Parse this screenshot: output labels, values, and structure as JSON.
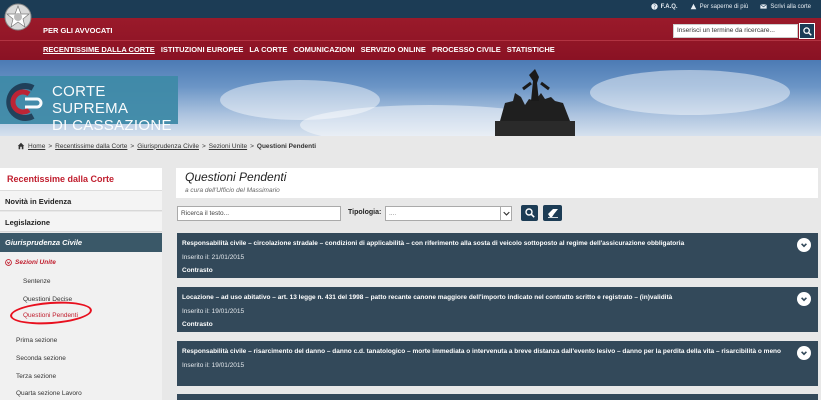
{
  "header": {
    "top_links": [
      {
        "icon": "help-icon",
        "label": "F.A.Q."
      },
      {
        "icon": "info-icon",
        "label": "Per saperne di più"
      },
      {
        "icon": "mail-icon",
        "label": "Scrivi alla corte"
      }
    ],
    "subtitle": "PER GLI AVVOCATI",
    "search_placeholder": "Inserisci un termine da ricercare...",
    "nav": [
      "RECENTISSIME DALLA CORTE",
      "ISTITUZIONI EUROPEE",
      "LA CORTE",
      "COMUNICAZIONI",
      "SERVIZIO ONLINE",
      "PROCESSO CIVILE",
      "STATISTICHE"
    ],
    "active_nav_index": 0
  },
  "hero": {
    "logo_line1": "CORTE SUPREMA",
    "logo_line2": "DI CASSAZIONE"
  },
  "breadcrumb": [
    "Home",
    "Recentissime dalla Corte",
    "Giurisprudenza Civile",
    "Sezioni Unite",
    "Questioni Pendenti"
  ],
  "sidebar": {
    "title": "Recentissime dalla Corte",
    "items": [
      "Novità in Evidenza",
      "Legislazione"
    ],
    "active_section": "Giurisprudenza Civile",
    "expanded": "Sezioni Unite",
    "subitems": [
      "Sentenze",
      "Questioni Decise",
      "Questioni Pendenti"
    ],
    "current_subitem": "Questioni Pendenti",
    "sections": [
      "Prima sezione",
      "Seconda sezione",
      "Terza sezione",
      "Quarta sezione Lavoro"
    ]
  },
  "main": {
    "title": "Questioni Pendenti",
    "subtitle": "a cura dell'Ufficio del Massimario",
    "search_placeholder": "Ricerca il testo...",
    "type_label": "Tipologia:",
    "type_value": "....",
    "cards": [
      {
        "title": "Responsabilità civile – circolazione stradale – condizioni di applicabilità – con riferimento alla sosta di veicolo sottoposto al regime dell'assicurazione obbligatoria",
        "date": "Inserito il: 21/01/2015",
        "tag": "Contrasto"
      },
      {
        "title": "Locazione – ad uso abitativo – art. 13 legge n. 431 del 1998 – patto recante canone maggiore dell'importo indicato nel contratto scritto e registrato – (in)validità",
        "date": "Inserito il: 19/01/2015",
        "tag": "Contrasto"
      },
      {
        "title": "Responsabilità civile – risarcimento del danno – danno c.d. tanatologico – morte immediata o intervenuta a breve distanza dall'evento lesivo – danno per la perdita della vita – risarcibilità o meno",
        "date": "Inserito il: 19/01/2015",
        "tag": ""
      }
    ]
  },
  "colors": {
    "top_bar": "#1c3c55",
    "red_band": "#8a1224",
    "accent_red": "#c01d2d",
    "card_bg": "#33495a",
    "annotation_circle": "#e8101f"
  }
}
